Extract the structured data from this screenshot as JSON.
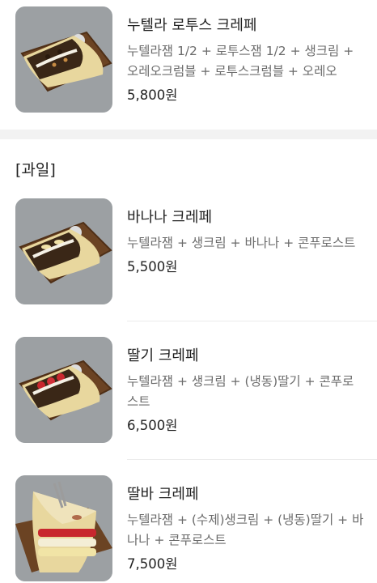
{
  "section": {
    "title": "[과일]"
  },
  "items": [
    {
      "name": "누텔라 로투스 크레페",
      "description": "누텔라잼 1/2 + 로투스잼 1/2 + 생크림 + 오레오크럼블 + 로투스크럼블 + 오레오",
      "price": "5,800원"
    },
    {
      "name": "바나나 크레페",
      "description": "누텔라잼 + 생크림 + 바나나 + 콘푸로스트",
      "price": "5,500원"
    },
    {
      "name": "딸기 크레페",
      "description": "누텔라잼 + 생크림 + (냉동)딸기 + 콘푸로스트",
      "price": "6,500원"
    },
    {
      "name": "딸바 크레페",
      "description": "누텔라잼 + (수제)생크림 + (냉동)딸기 + 바나나 + 콘푸로스트",
      "price": "7,500원"
    }
  ],
  "colors": {
    "background": "#ffffff",
    "section_gap": "#f2f2f2",
    "text": "#222222",
    "muted": "#6b6b6b",
    "divider": "#ececec"
  }
}
